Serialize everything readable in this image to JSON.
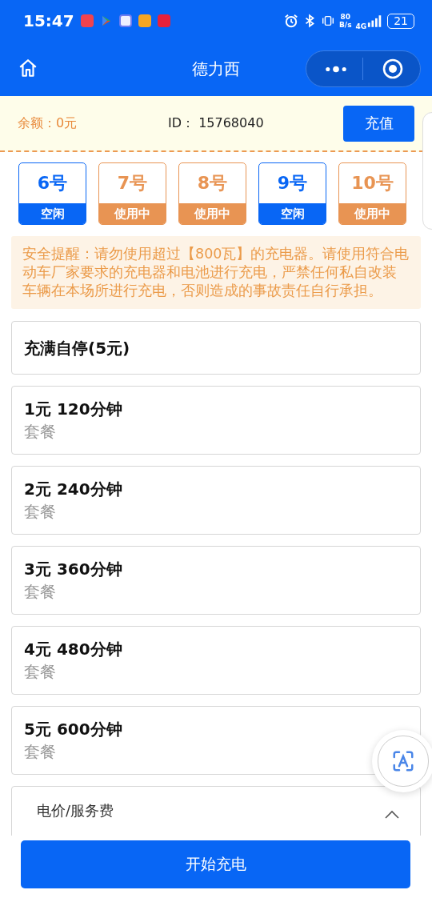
{
  "status_bar": {
    "time": "15:47",
    "speed_value": "80",
    "speed_unit": "B/s",
    "network": "4G",
    "battery": "21"
  },
  "header": {
    "title": "德力西"
  },
  "account": {
    "balance": "余额：0元",
    "id": "ID：  15768040",
    "recharge_button": "充值"
  },
  "ports": [
    {
      "number": "6号",
      "status": "空闲",
      "busy": false
    },
    {
      "number": "7号",
      "status": "使用中",
      "busy": true
    },
    {
      "number": "8号",
      "status": "使用中",
      "busy": true
    },
    {
      "number": "9号",
      "status": "空闲",
      "busy": false
    },
    {
      "number": "10号",
      "status": "使用中",
      "busy": true
    }
  ],
  "notice": "安全提醒：请勿使用超过【800瓦】的充电器。请使用符合电动车厂家要求的充电器和电池进行充电，严禁任何私自改装车辆在本场所进行充电，否则造成的事故责任自行承担。",
  "plans": [
    {
      "title": "充满自停(5元)"
    },
    {
      "title": "1元 120分钟",
      "subtitle": "套餐"
    },
    {
      "title": "2元 240分钟",
      "subtitle": "套餐"
    },
    {
      "title": "3元 360分钟",
      "subtitle": "套餐"
    },
    {
      "title": "4元 480分钟",
      "subtitle": "套餐"
    },
    {
      "title": "5元 600分钟",
      "subtitle": "套餐"
    }
  ],
  "price_section": {
    "title": "电价/服务费",
    "expanded": true
  },
  "start_button": "开始充电"
}
